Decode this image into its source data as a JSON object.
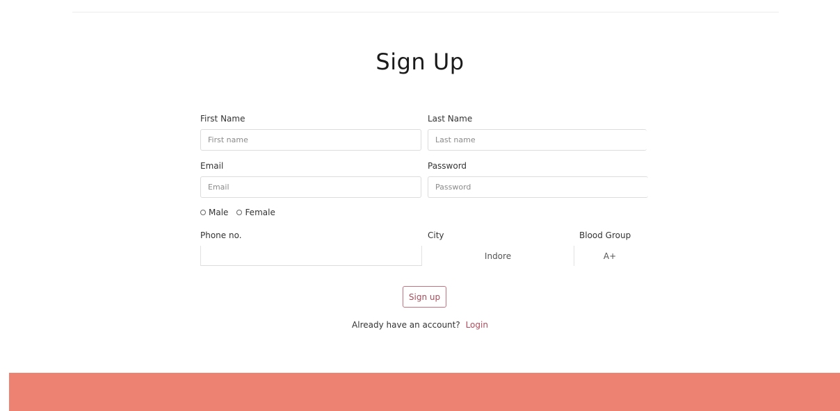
{
  "page": {
    "title": "Sign Up"
  },
  "form": {
    "first_name": {
      "label": "First Name",
      "placeholder": "First name",
      "value": ""
    },
    "last_name": {
      "label": "Last Name",
      "placeholder": "Last name",
      "value": ""
    },
    "email": {
      "label": "Email",
      "placeholder": "Email",
      "value": ""
    },
    "password": {
      "label": "Password",
      "placeholder": "Password",
      "value": ""
    },
    "gender": {
      "options": [
        "Male",
        "Female"
      ]
    },
    "phone": {
      "label": "Phone no.",
      "value": ""
    },
    "city": {
      "label": "City",
      "selected": "Indore"
    },
    "blood_group": {
      "label": "Blood Group",
      "selected": "A+"
    },
    "submit_label": "Sign up",
    "account_prompt": "Already have an account?",
    "login_label": "Login"
  },
  "colors": {
    "footer_band": "#ee8272",
    "accent": "#b04a5a"
  }
}
